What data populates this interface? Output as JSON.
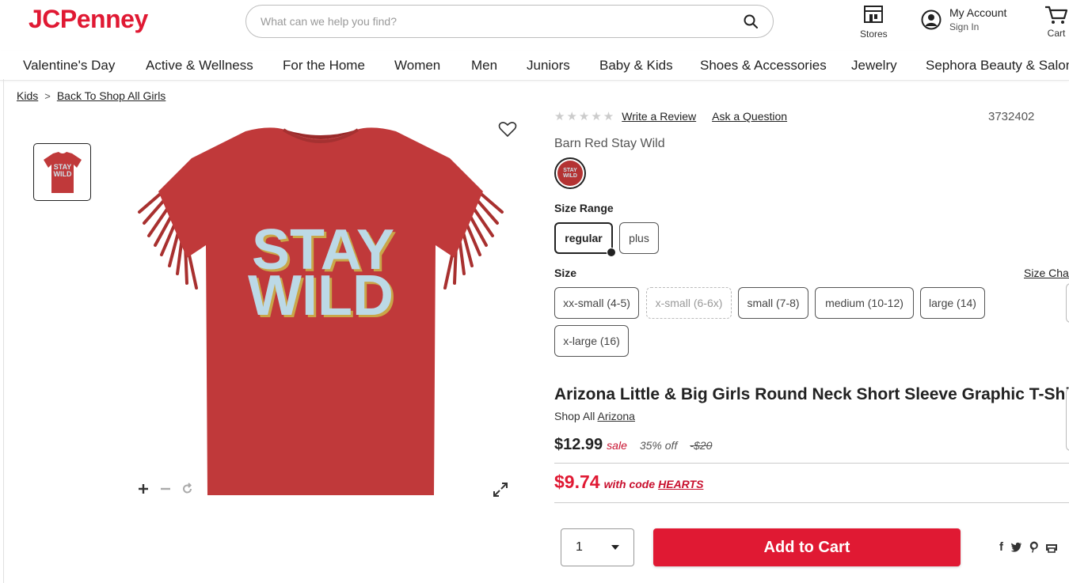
{
  "brand": {
    "logo": "JCPenney",
    "color": "#e01933"
  },
  "search": {
    "placeholder": "What can we help you find?"
  },
  "utilities": {
    "stores": "Stores",
    "account_title": "My Account",
    "account_sub": "Sign In",
    "cart": "Cart"
  },
  "nav": [
    "Valentine's Day",
    "Active & Wellness",
    "For the Home",
    "Women",
    "Men",
    "Juniors",
    "Baby & Kids",
    "Shoes & Accessories",
    "Jewelry",
    "Sephora Beauty & Salon"
  ],
  "breadcrumb": {
    "kids": "Kids",
    "sep": ">",
    "back": "Back To Shop All Girls"
  },
  "product": {
    "graphic_line1": "STAY",
    "graphic_line2": "WILD",
    "thumb_text": "STAY WILD",
    "rating_stars": 0,
    "write_review": "Write a Review",
    "ask_question": "Ask a Question",
    "sku": "3732402",
    "color_name": "Barn Red Stay Wild",
    "size_range_label": "Size Range",
    "size_ranges": [
      {
        "label": "regular",
        "selected": true
      },
      {
        "label": "plus",
        "selected": false
      }
    ],
    "size_label": "Size",
    "size_chart": "Size Chart",
    "sizes": [
      {
        "label": "xx-small (4-5)",
        "available": true
      },
      {
        "label": "x-small (6-6x)",
        "available": false
      },
      {
        "label": "small (7-8)",
        "available": true
      },
      {
        "label": "medium (10-12)",
        "available": true
      },
      {
        "label": "large (14)",
        "available": true
      },
      {
        "label": "x-large (16)",
        "available": true
      }
    ],
    "title": "Arizona Little & Big Girls Round Neck Short Sleeve Graphic T-Shirt",
    "shop_all_prefix": "Shop All",
    "shop_all_brand": "Arizona",
    "price": "$12.99",
    "sale_label": "sale",
    "percent_off": "35% off",
    "original_price": "-$20",
    "coupon_price": "$9.74",
    "coupon_text": "with code",
    "coupon_code": "HEARTS",
    "quantity": "1",
    "add_to_cart": "Add to Cart",
    "shirt_color": "#c0393a"
  }
}
